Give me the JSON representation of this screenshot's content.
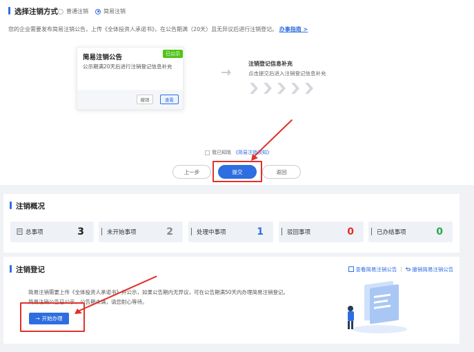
{
  "method": {
    "title": "选择注销方式",
    "options": [
      "普通注销",
      "简易注销"
    ],
    "selected": 1,
    "description": "您的企业需要发布简易注销公告，上传《全体投资人承诺书》，在公告期满（20天）且无异议后进行注销登记。",
    "guide_link": "办事指南 >"
  },
  "steps": {
    "notice": {
      "title": "简易注销公告",
      "badge": "已公示",
      "subtitle": "公示期满20天后进行注销登记信息补充",
      "btn_cancel": "撤销",
      "btn_view": "查看"
    },
    "next": {
      "title": "注销登记信息补充",
      "subtitle": "点击提交后进入注销登记信息补充"
    }
  },
  "agreement": {
    "prefix": "我已知晓",
    "link": "《简易注销须知》"
  },
  "actions": {
    "prev": "上一步",
    "submit": "提交",
    "back": "返回"
  },
  "overview": {
    "title": "注销概况",
    "stats": [
      {
        "label": "总事项",
        "value": "3",
        "color": "#222222"
      },
      {
        "label": "未开始事项",
        "value": "2",
        "color": "#888888"
      },
      {
        "label": "处理中事项",
        "value": "1",
        "color": "#2f6ee0"
      },
      {
        "label": "驳回事项",
        "value": "0",
        "color": "#e0302a"
      },
      {
        "label": "已办结事项",
        "value": "0",
        "color": "#2aa84a"
      }
    ]
  },
  "registration": {
    "title": "注销登记",
    "link_view": "查看简易注销公告",
    "link_revoke": "撤销简易注销公告",
    "line1": "简易注销需要上传《全体投资人承诺书》并公示，如果公告期内无异议，可在公告期满50天内办理简易注销登记。",
    "line2": "简易注销公告已公示，公告期未满，请您耐心等待。",
    "start_button": "开始办理"
  },
  "colors": {
    "accent": "#2f6ee0",
    "highlight": "#e0302a",
    "success": "#52c41a"
  }
}
